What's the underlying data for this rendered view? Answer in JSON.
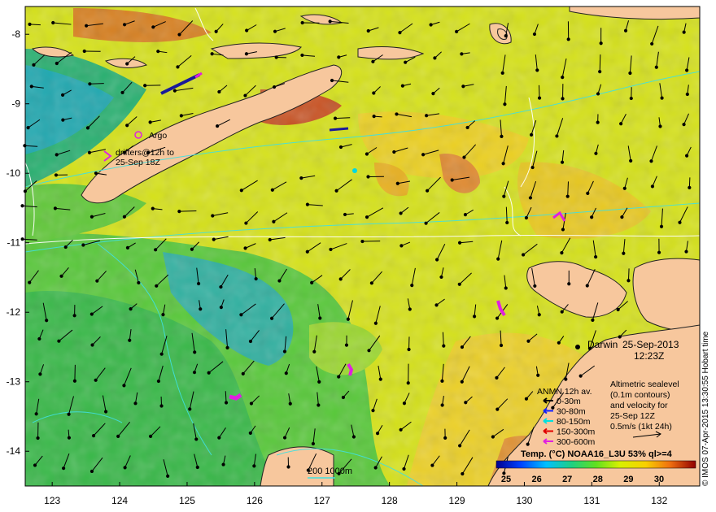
{
  "axes": {
    "x_ticks": [
      "123",
      "124",
      "125",
      "126",
      "127",
      "128",
      "129",
      "130",
      "131",
      "132"
    ],
    "y_ticks": [
      "-8",
      "-9",
      "-10",
      "-11",
      "-12",
      "-13",
      "-14"
    ],
    "lon_range": [
      122.6,
      132.6
    ],
    "lat_range": [
      -14.5,
      -7.6
    ]
  },
  "place_labels": {
    "darwin": "Darwin",
    "date": "25-Sep-2013",
    "time": "12:23Z"
  },
  "legend_argo": {
    "argo_label": "Argo",
    "drifters_line1": "drifters@12h to",
    "drifters_line2": "25-Sep 18Z"
  },
  "legend_altimetry": {
    "line1": "Altimetric sealevel",
    "line2": "(0.1m contours)",
    "line3": "and velocity for",
    "line4": "25-Sep 12Z",
    "line5": "0.5m/s (1kt 24h)"
  },
  "legend_anmn": {
    "title": "ANMN 12h av.",
    "items": [
      {
        "label": "0-30m",
        "color": "#000000"
      },
      {
        "label": "30-80m",
        "color": "#1020ff"
      },
      {
        "label": "80-150m",
        "color": "#00e0e0"
      },
      {
        "label": "150-300m",
        "color": "#e00000"
      },
      {
        "label": "300-600m",
        "color": "#e020e0"
      }
    ]
  },
  "colorbar": {
    "title": "Temp. (°C) NOAA16_L3U 53% ql>=4",
    "ticks": [
      "25",
      "26",
      "27",
      "28",
      "29",
      "30"
    ]
  },
  "scale_bar": {
    "label": "200  1000m"
  },
  "credit": "© IMOS 07-Apr-2015 13:30:55 Hobart time",
  "colors": {
    "land": "#f7c79d",
    "sst_warm": "#f0a020",
    "sst_mid": "#e8e818",
    "sst_cool": "#30c050",
    "sst_cold": "#10a0d0"
  }
}
